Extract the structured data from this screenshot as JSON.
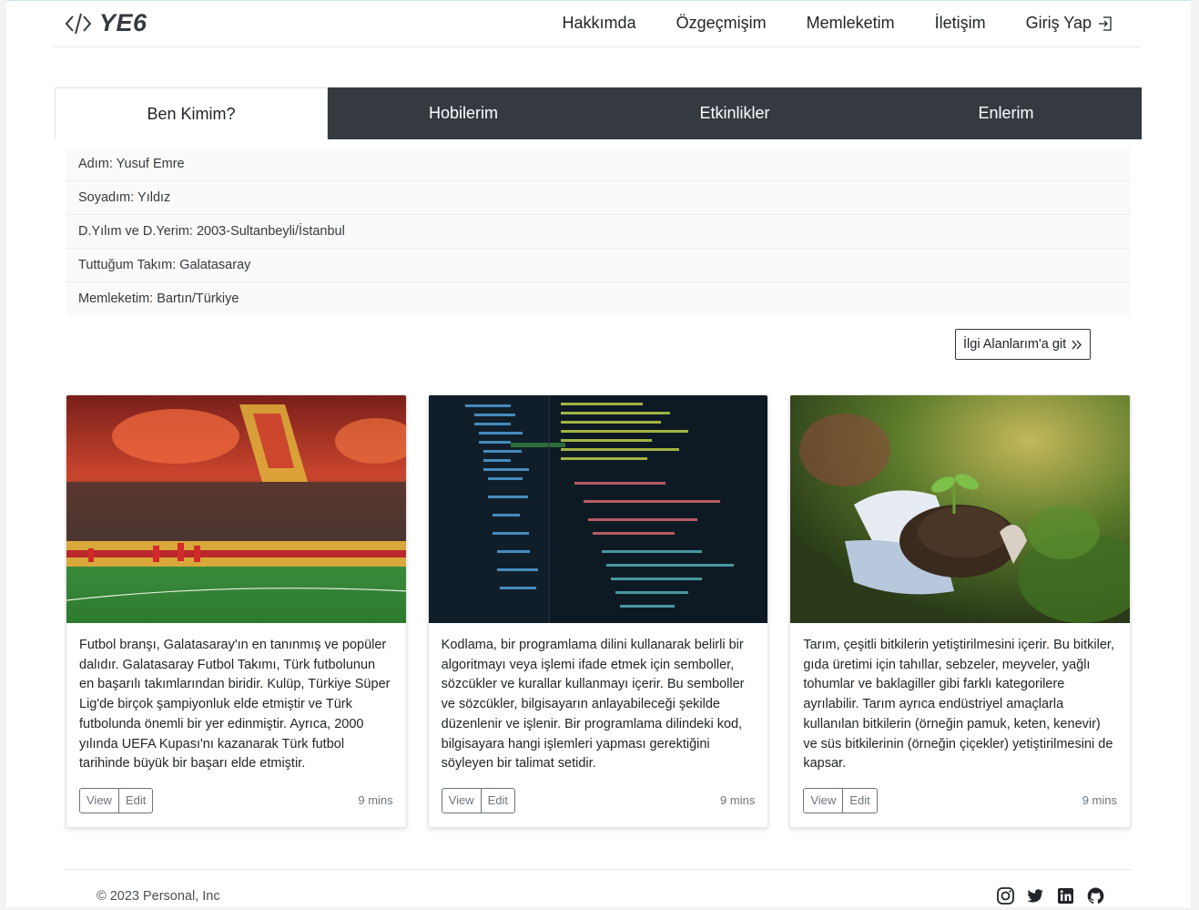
{
  "brand": {
    "text": "YE6",
    "icon": "code-icon"
  },
  "nav": {
    "items": [
      {
        "label": "Hakkımda"
      },
      {
        "label": "Özgeçmişim"
      },
      {
        "label": "Memleketim"
      },
      {
        "label": "İletişim"
      },
      {
        "label": "Giriş Yap",
        "icon": "login-icon"
      }
    ]
  },
  "tabs": [
    {
      "label": "Ben Kimim?",
      "active": true
    },
    {
      "label": "Hobilerim"
    },
    {
      "label": "Etkinlikler"
    },
    {
      "label": "Enlerim"
    }
  ],
  "info": [
    "Adım: Yusuf Emre",
    "Soyadım: Yıldız",
    "D.Yılım ve D.Yerim: 2003-Sultanbeyli/İstanbul",
    "Tuttuğum Takım: Galatasaray",
    "Memleketim: Bartın/Türkiye"
  ],
  "interest_button": {
    "label": "İlgi Alanlarım'a git",
    "icon": "double-chevron-right-icon"
  },
  "cards": [
    {
      "image": "football-stadium-image",
      "text": "Futbol branşı, Galatasaray'ın en tanınmış ve popüler dalıdır. Galatasaray Futbol Takımı, Türk futbolunun en başarılı takımlarından biridir. Kulüp, Türkiye Süper Lig'de birçok şampiyonluk elde etmiştir ve Türk futbolunda önemli bir yer edinmiştir. Ayrıca, 2000 yılında UEFA Kupası'nı kazanarak Türk futbol tarihinde büyük bir başarı elde etmiştir.",
      "view": "View",
      "edit": "Edit",
      "time": "9 mins"
    },
    {
      "image": "code-editor-image",
      "text": "Kodlama, bir programlama dilini kullanarak belirli bir algoritmayı veya işlemi ifade etmek için semboller, sözcükler ve kurallar kullanmayı içerir. Bu semboller ve sözcükler, bilgisayarın anlayabileceği şekilde düzenlenir ve işlenir. Bir programlama dilindeki kod, bilgisayara hangi işlemleri yapması gerektiğini söyleyen bir talimat setidir.",
      "view": "View",
      "edit": "Edit",
      "time": "9 mins"
    },
    {
      "image": "hands-soil-plant-image",
      "text": "Tarım, çeşitli bitkilerin yetiştirilmesini içerir. Bu bitkiler, gıda üretimi için tahıllar, sebzeler, meyveler, yağlı tohumlar ve baklagiller gibi farklı kategorilere ayrılabilir. Tarım ayrıca endüstriyel amaçlarla kullanılan bitkilerin (örneğin pamuk, keten, kenevir) ve süs bitkilerinin (örneğin çiçekler) yetiştirilmesini de kapsar.",
      "view": "View",
      "edit": "Edit",
      "time": "9 mins"
    }
  ],
  "footer": {
    "copyright": "© 2023 Personal, Inc",
    "social": [
      "instagram-icon",
      "twitter-icon",
      "linkedin-icon",
      "github-icon"
    ]
  }
}
